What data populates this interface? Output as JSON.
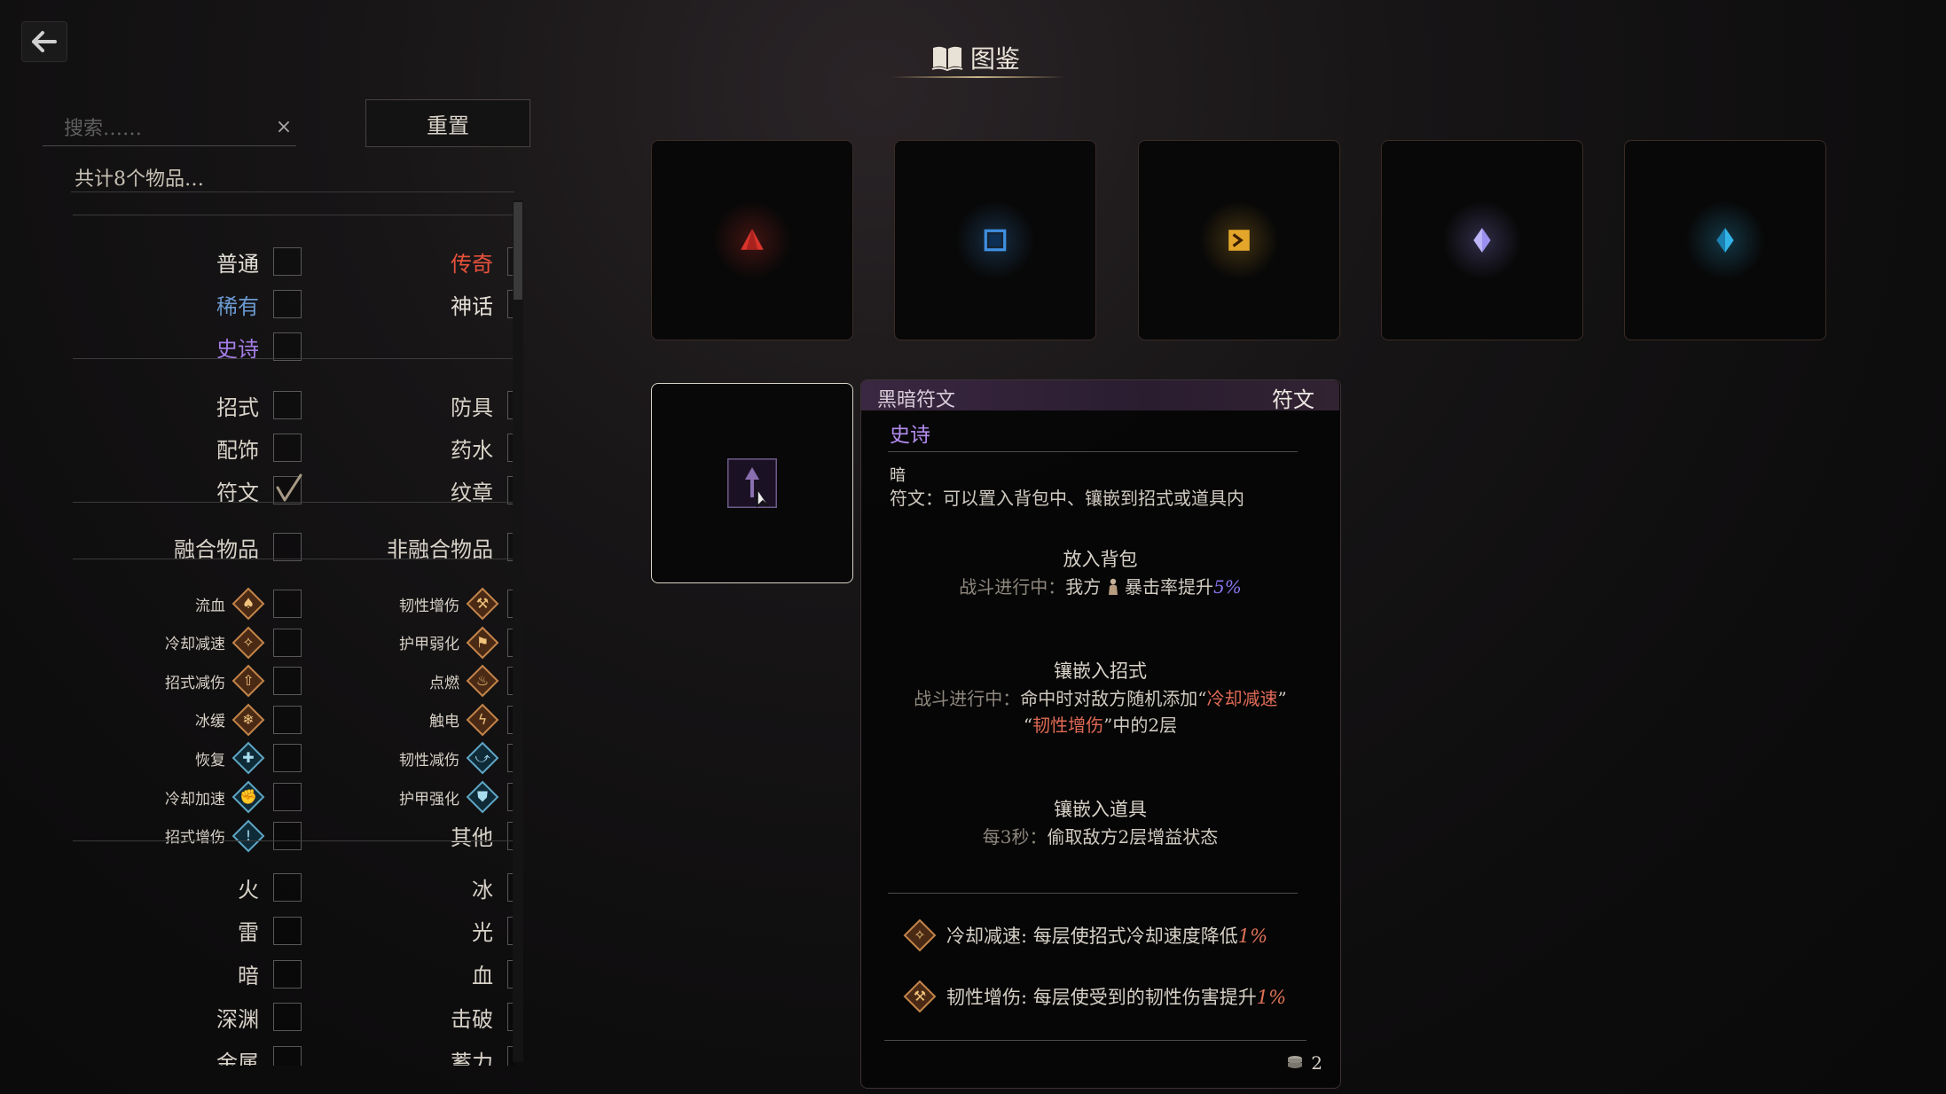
{
  "header": {
    "title": "图鉴"
  },
  "search": {
    "placeholder": "搜索……",
    "clear": "×",
    "reset_label": "重置"
  },
  "count_text": "共计8个物品…",
  "filters": {
    "rarity": [
      {
        "label": "普通",
        "color": "#e4dfd6"
      },
      {
        "label": "传奇",
        "color": "#e8513c"
      },
      {
        "label": "稀有",
        "color": "#6b9ad0"
      },
      {
        "label": "神话",
        "color": "#e4dfd6"
      },
      {
        "label": "史诗",
        "color": "#a57ee8"
      }
    ],
    "category": [
      {
        "label": "招式",
        "checked": false
      },
      {
        "label": "防具",
        "checked": false
      },
      {
        "label": "配饰",
        "checked": false
      },
      {
        "label": "药水",
        "checked": false
      },
      {
        "label": "符文",
        "checked": true
      },
      {
        "label": "纹章",
        "checked": false
      }
    ],
    "fusion": [
      "融合物品",
      "非融合物品"
    ],
    "effects": [
      {
        "label": "流血",
        "icon": "bleed-icon"
      },
      {
        "label": "韧性增伤",
        "icon": "toughness-damage-up-icon"
      },
      {
        "label": "冷却减速",
        "icon": "cooldown-slow-icon"
      },
      {
        "label": "护甲弱化",
        "icon": "armor-weaken-icon"
      },
      {
        "label": "招式减伤",
        "icon": "skill-damage-reduce-icon"
      },
      {
        "label": "点燃",
        "icon": "ignite-icon"
      },
      {
        "label": "冰缓",
        "icon": "frost-slow-icon"
      },
      {
        "label": "触电",
        "icon": "shock-icon"
      },
      {
        "label": "恢复",
        "icon": "recovery-icon"
      },
      {
        "label": "韧性减伤",
        "icon": "toughness-reduce-icon"
      },
      {
        "label": "冷却加速",
        "icon": "cooldown-haste-icon"
      },
      {
        "label": "护甲强化",
        "icon": "armor-strengthen-icon"
      },
      {
        "label": "招式增伤",
        "icon": "skill-damage-up-icon"
      },
      {
        "label": "其他",
        "icon": ""
      }
    ],
    "elements": [
      "火",
      "冰",
      "雷",
      "光",
      "暗",
      "血",
      "深渊",
      "击破",
      "金属",
      "蓄力"
    ]
  },
  "items": [
    {
      "icon": "red-triangle-rune-icon",
      "color": "#d8342c"
    },
    {
      "icon": "blue-square-rune-icon",
      "color": "#3f8fe0"
    },
    {
      "icon": "gold-chevron-rune-icon",
      "color": "#e3a62a"
    },
    {
      "icon": "violet-crystal-rune-icon",
      "color": "#9b8ff0"
    },
    {
      "icon": "cyan-crystal-rune-icon",
      "color": "#33b4e8"
    },
    {
      "icon": "dark-rune-icon",
      "color": "#8a6fb0"
    }
  ],
  "tooltip": {
    "name": "黑暗符文",
    "type": "符文",
    "rarity": "史诗",
    "element": "暗",
    "description": "符文：可以置入背包中、镶嵌到招式或道具内",
    "bag_title": "放入背包",
    "bag_prefix": "战斗进行中：",
    "bag_text_a": "我方",
    "bag_text_b": "暴击率提升",
    "bag_value": "5%",
    "skill_title": "镶嵌入招式",
    "skill_prefix": "战斗进行中：",
    "skill_text_a": "命中时对敌方随机添加“",
    "skill_red_1": "冷却减速",
    "skill_text_b": "”",
    "skill_text_c": "“",
    "skill_red_2": "韧性增伤",
    "skill_text_d": "”中的2层",
    "prop_title": "镶嵌入道具",
    "prop_prefix": "每3秒：",
    "prop_text": "偷取敌方2层增益状态",
    "tag1_text": "冷却减速: 每层使招式冷却速度降低",
    "tag1_value": "1%",
    "tag2_text": "韧性增伤: 每层使受到的韧性伤害提升",
    "tag2_value": "1%",
    "cost": "2"
  }
}
